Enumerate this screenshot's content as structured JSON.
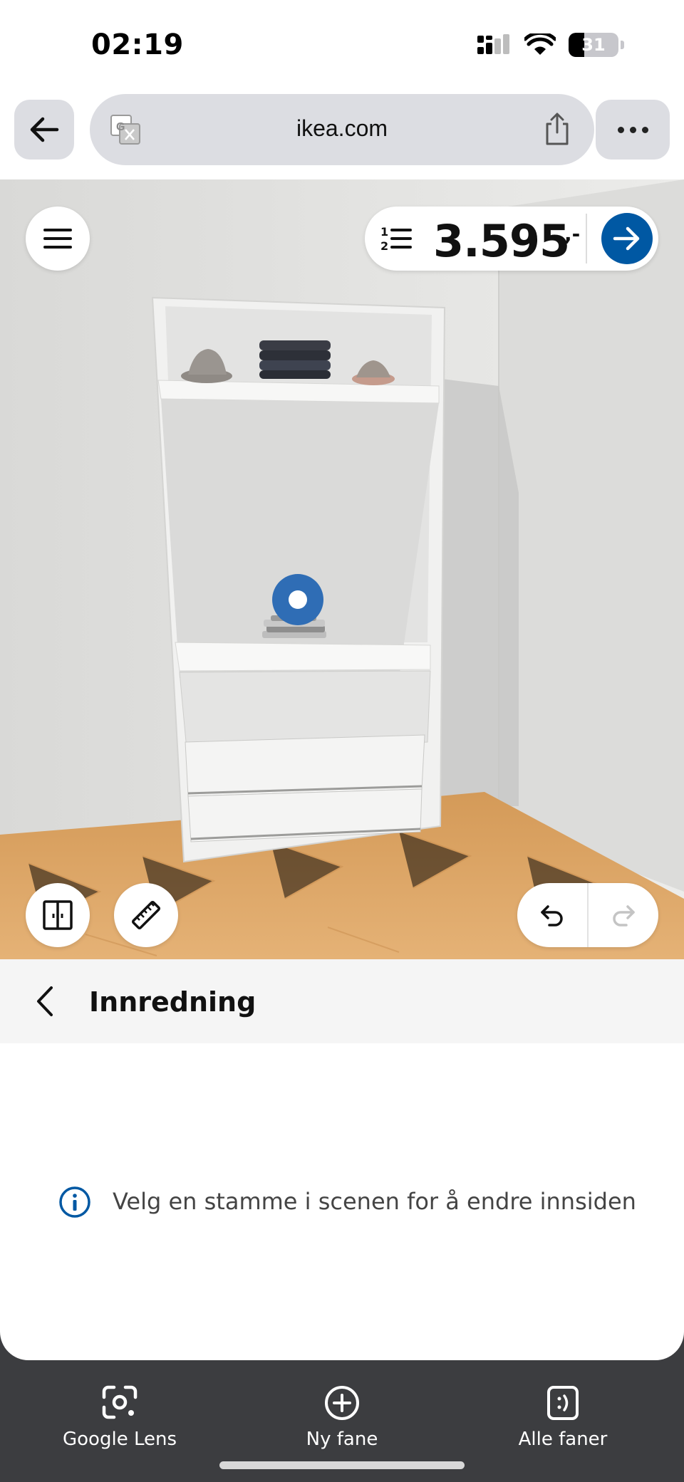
{
  "status_bar": {
    "time": "02:19",
    "battery": "31",
    "battery_level": 0.31
  },
  "browser": {
    "url": "ikea.com",
    "icons": {
      "back": "arrow-left-icon",
      "translate": "translate-icon",
      "share": "share-icon",
      "more": "more-horizontal-icon"
    }
  },
  "scene": {
    "price": {
      "value": "3.595",
      "suffix": ",-"
    },
    "icons": {
      "menu": "hamburger-menu-icon",
      "list": "numbered-list-icon",
      "go": "arrow-right-icon",
      "doors": "wardrobe-doors-icon",
      "measure": "ruler-icon",
      "undo": "undo-icon",
      "redo": "redo-icon"
    },
    "colors": {
      "accent": "#0058a3",
      "selection": "#2f6db5"
    }
  },
  "panel": {
    "title": "Innredning",
    "info": "Velg en stamme i scenen for å endre innsiden"
  },
  "bottom_bar": {
    "items": [
      {
        "label": "Google Lens",
        "icon": "google-lens-icon"
      },
      {
        "label": "Ny fane",
        "icon": "new-tab-icon"
      },
      {
        "label": "Alle faner",
        "icon": "all-tabs-icon"
      }
    ]
  }
}
